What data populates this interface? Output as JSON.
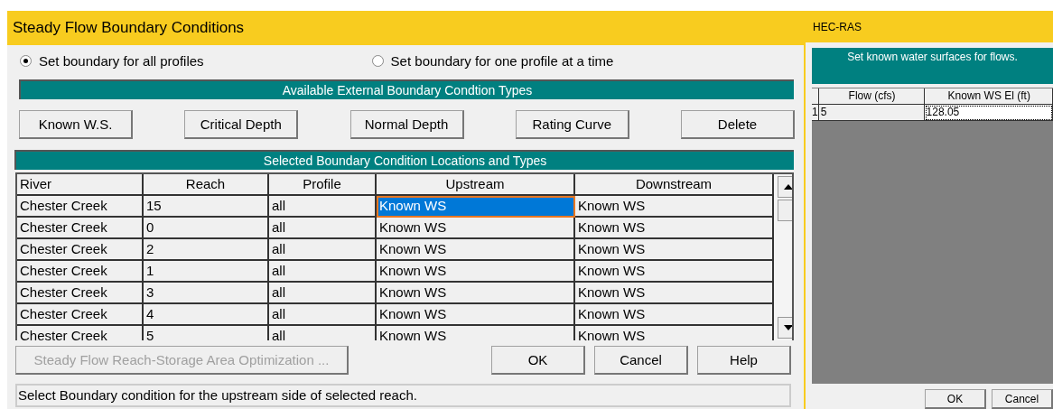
{
  "main_window": {
    "title": "Steady Flow Boundary Conditions",
    "radios": [
      {
        "label": "Set boundary for all profiles",
        "selected": true
      },
      {
        "label": "Set boundary for one profile at a time",
        "selected": false
      }
    ],
    "types_header": "Available External Boundary Condtion Types",
    "type_buttons": [
      "Known W.S.",
      "Critical Depth",
      "Normal Depth",
      "Rating Curve",
      "Delete"
    ],
    "table_header": "Selected Boundary Condition Locations and Types",
    "table": {
      "columns": [
        "River",
        "Reach",
        "Profile",
        "Upstream",
        "Downstream"
      ],
      "rows": [
        {
          "river": "Chester Creek",
          "reach": "15",
          "profile": "all",
          "upstream": "Known WS",
          "downstream": "Known WS",
          "selected": true
        },
        {
          "river": "Chester Creek",
          "reach": "0",
          "profile": "all",
          "upstream": "Known WS",
          "downstream": "Known WS",
          "selected": false
        },
        {
          "river": "Chester Creek",
          "reach": "2",
          "profile": "all",
          "upstream": "Known WS",
          "downstream": "Known WS",
          "selected": false
        },
        {
          "river": "Chester Creek",
          "reach": "1",
          "profile": "all",
          "upstream": "Known WS",
          "downstream": "Known WS",
          "selected": false
        },
        {
          "river": "Chester Creek",
          "reach": "3",
          "profile": "all",
          "upstream": "Known WS",
          "downstream": "Known WS",
          "selected": false
        },
        {
          "river": "Chester Creek",
          "reach": "4",
          "profile": "all",
          "upstream": "Known WS",
          "downstream": "Known WS",
          "selected": false
        },
        {
          "river": "Chester Creek",
          "reach": "5",
          "profile": "all",
          "upstream": "Known WS",
          "downstream": "Known WS",
          "selected": false
        }
      ]
    },
    "optimization_button": {
      "label": "Steady Flow Reach-Storage Area Optimization ...",
      "disabled": true
    },
    "buttons": [
      "OK",
      "Cancel",
      "Help"
    ],
    "status_bar": "Select Boundary condition for the upstream side of selected reach."
  },
  "dialog": {
    "title": "HEC-RAS",
    "header": "Set known water surfaces for flows.",
    "table": {
      "columns": [
        "Flow (cfs)",
        "Known WS El (ft)"
      ],
      "rows": [
        {
          "number": "1",
          "flow": "5",
          "ws": "128.05"
        }
      ]
    },
    "buttons": [
      "OK",
      "Cancel"
    ]
  }
}
